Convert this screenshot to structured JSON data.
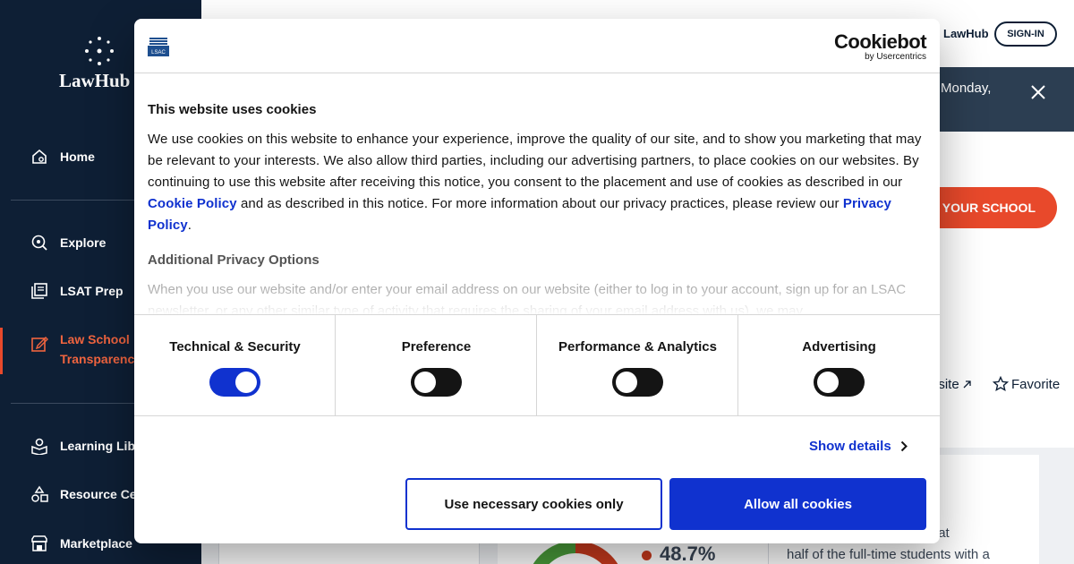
{
  "sidebar": {
    "logo_text": "LawHub",
    "items": [
      {
        "label": "Home",
        "icon": "home-icon"
      },
      {
        "label": "Explore",
        "icon": "explore-icon"
      },
      {
        "label": "LSAT Prep",
        "icon": "lsat-prep-icon"
      },
      {
        "label": "Law School Transparency",
        "icon": "transparency-icon",
        "active": true
      },
      {
        "label": "Learning Libr",
        "icon": "learning-library-icon"
      },
      {
        "label": "Resource Cen",
        "icon": "resource-center-icon"
      },
      {
        "label": "Marketplace",
        "icon": "marketplace-icon"
      }
    ]
  },
  "header": {
    "goto_label": "LawHub",
    "signin_label": "SIGN-IN"
  },
  "notice": {
    "text": "Monday,"
  },
  "page": {
    "find_school_label": "D YOUR SCHOOL",
    "website_label": "bsite",
    "favorite_label": "Favorite",
    "stat_value": "48.7%",
    "desc_lines": [
      "t",
      "eans that",
      "half of the full-time students with a"
    ]
  },
  "cookie_dialog": {
    "brand": "Cookiebot",
    "brand_by": "by Usercentrics",
    "title": "This website uses cookies",
    "body_before_cookie_link": "We use cookies on this website to enhance your experience, improve the quality of our site, and to show you marketing that may be relevant to your interests. We also allow third parties, including our advertising partners, to place cookies on our websites. By continuing to use this website after receiving this notice, you consent to the placement and use of cookies as described in our ",
    "cookie_policy_link": "Cookie Policy",
    "body_between_links": " and as described in this notice. For more information about our privacy practices, please review our ",
    "privacy_policy_link": "Privacy Policy",
    "body_end": ".",
    "subtitle": "Additional Privacy Options",
    "faded_text": "When you use our website and/or enter your email address on our website (either to log in to your account, sign up for an LSAC newsletter, or any other similar type of activity that requires the sharing of your email address with us), we may",
    "toggles": [
      {
        "label": "Technical & Security",
        "on": true
      },
      {
        "label": "Preference",
        "on": false
      },
      {
        "label": "Performance & Analytics",
        "on": false
      },
      {
        "label": "Advertising",
        "on": false
      }
    ],
    "show_details_label": "Show details",
    "necessary_label": "Use necessary cookies only",
    "allow_label": "Allow all cookies"
  },
  "colors": {
    "sidebar_bg": "#0e1f35",
    "accent": "#e8492b",
    "cookiebot_blue": "#1032cf"
  }
}
